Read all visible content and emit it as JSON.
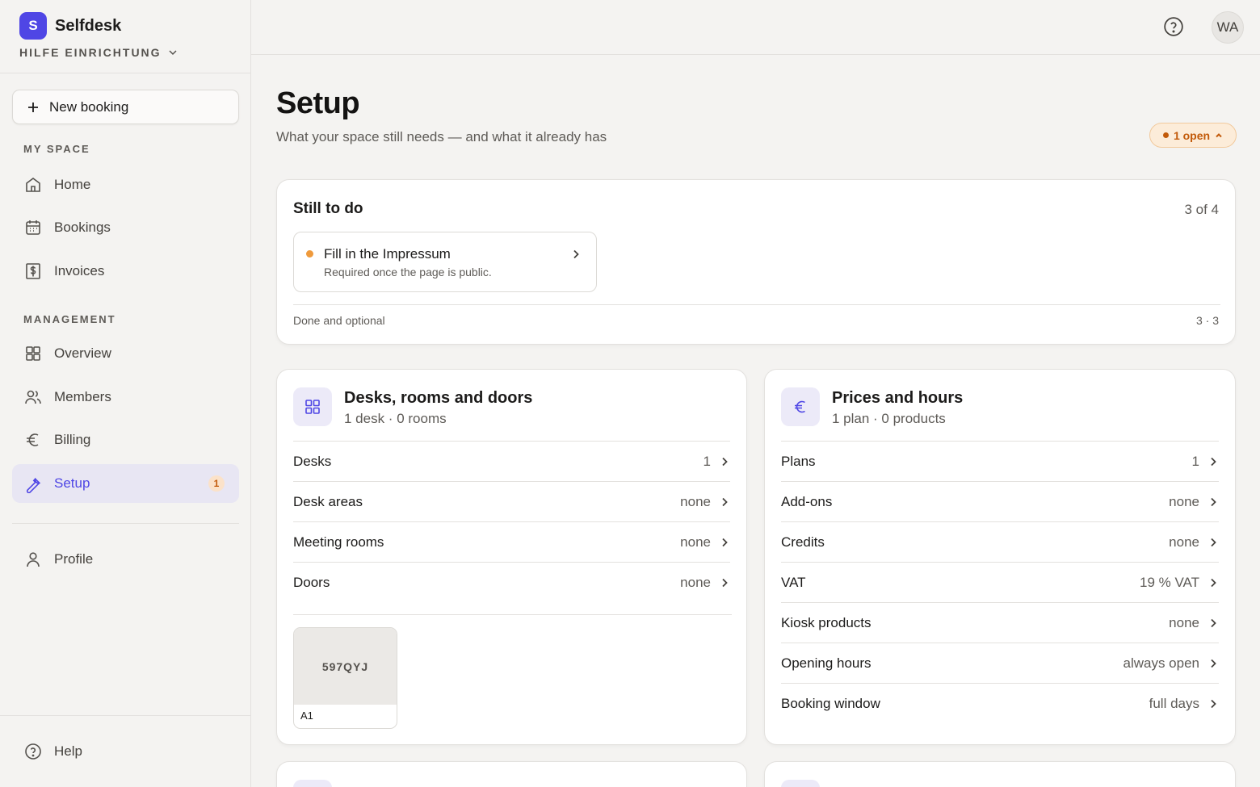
{
  "app": {
    "logo_letter": "S",
    "name": "Selfdesk",
    "workspace": "HILFE EINRICHTUNG"
  },
  "sidebar": {
    "new_booking": "New booking",
    "section_my_space": "MY SPACE",
    "section_management": "MANAGEMENT",
    "items": [
      {
        "label": "Home",
        "icon": "home-icon"
      },
      {
        "label": "Bookings",
        "icon": "calendar-icon"
      },
      {
        "label": "Invoices",
        "icon": "invoice-icon"
      },
      {
        "label": "Overview",
        "icon": "grid-icon"
      },
      {
        "label": "Members",
        "icon": "users-icon"
      },
      {
        "label": "Billing",
        "icon": "euro-icon"
      },
      {
        "label": "Setup",
        "icon": "wrench-icon",
        "active": true,
        "badge": "1"
      },
      {
        "label": "Profile",
        "icon": "user-icon"
      },
      {
        "label": "Help",
        "icon": "help-icon"
      }
    ]
  },
  "topbar": {
    "avatar_initials": "WA"
  },
  "page": {
    "title": "Setup",
    "subtitle": "What your space still needs — and what it already has",
    "open_pill": "1 open"
  },
  "todo": {
    "title": "Still to do",
    "count": "3 of 4",
    "item_title": "Fill in the Impressum",
    "item_sub": "Required once the page is public.",
    "done_label": "Done and optional",
    "done_count": "3 · 3"
  },
  "desks": {
    "title": "Desks, rooms and doors",
    "sub": "1 desk · 0 rooms",
    "rows": [
      {
        "label": "Desks",
        "value": "1"
      },
      {
        "label": "Desk areas",
        "value": "none"
      },
      {
        "label": "Meeting rooms",
        "value": "none"
      },
      {
        "label": "Doors",
        "value": "none"
      }
    ],
    "tile_code": "597QYJ",
    "tile_name": "A1"
  },
  "prices": {
    "title": "Prices and hours",
    "sub": "1 plan · 0 products",
    "rows": [
      {
        "label": "Plans",
        "value": "1"
      },
      {
        "label": "Add-ons",
        "value": "none"
      },
      {
        "label": "Credits",
        "value": "none"
      },
      {
        "label": "VAT",
        "value": "19 % VAT"
      },
      {
        "label": "Kiosk products",
        "value": "none"
      },
      {
        "label": "Opening hours",
        "value": "always open"
      },
      {
        "label": "Booking window",
        "value": "full days"
      }
    ]
  },
  "colors": {
    "accent": "#4f46e5",
    "warning": "#c25a0a",
    "todo_dot": "#ef9a3c"
  }
}
